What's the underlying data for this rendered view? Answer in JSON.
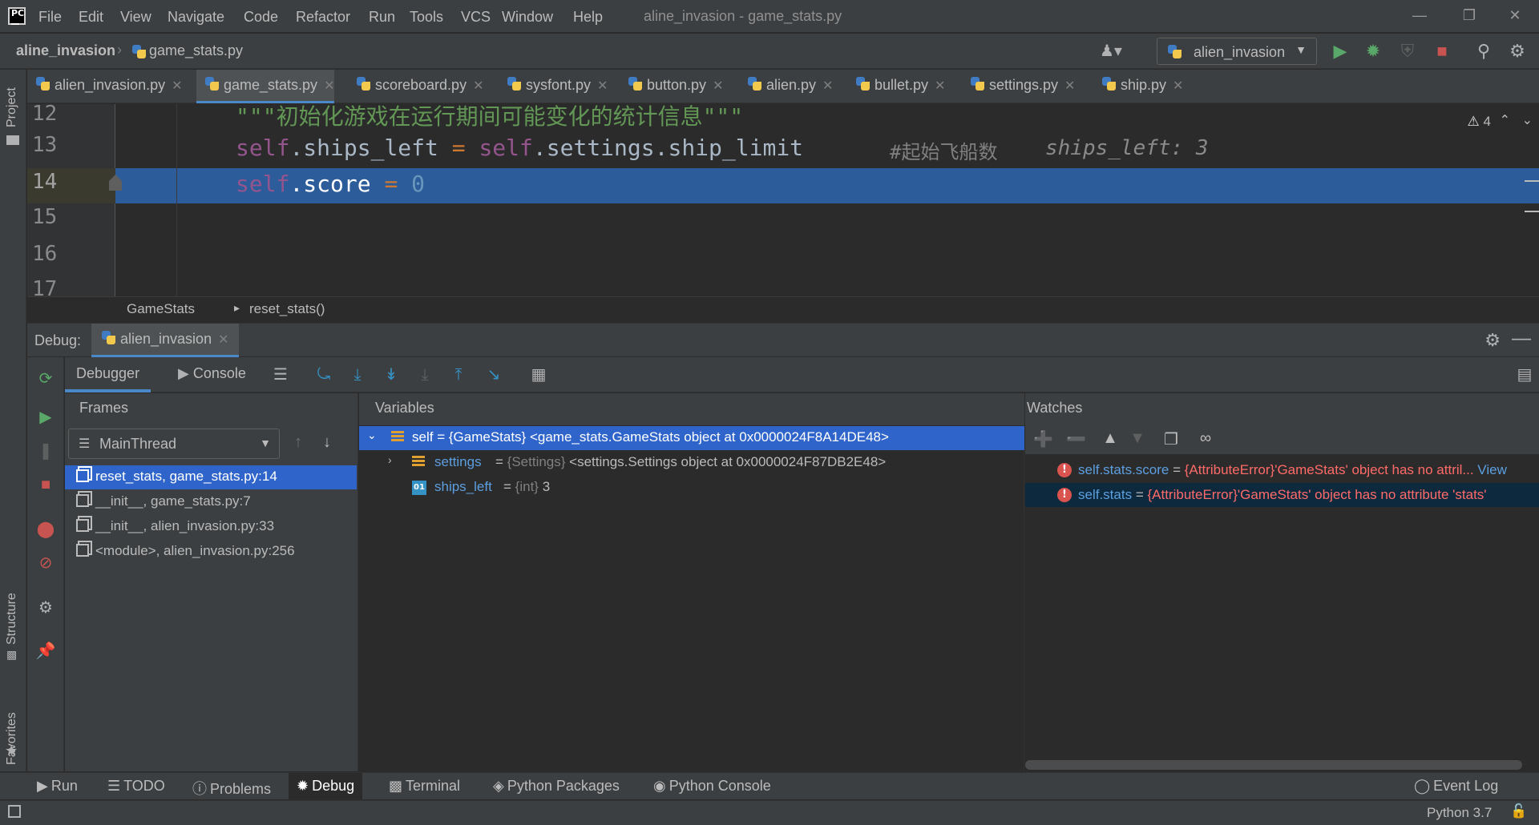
{
  "menu": [
    "File",
    "Edit",
    "View",
    "Navigate",
    "Code",
    "Refactor",
    "Run",
    "Tools",
    "VCS",
    "Window",
    "Help"
  ],
  "window_title": "aline_invasion - game_stats.py",
  "nav": {
    "project": "aline_invasion",
    "file": "game_stats.py",
    "run_config": "alien_invasion"
  },
  "editor_tabs": [
    "alien_invasion.py",
    "game_stats.py",
    "scoreboard.py",
    "sysfont.py",
    "button.py",
    "alien.py",
    "bullet.py",
    "settings.py",
    "ship.py"
  ],
  "editor_active_tab": "game_stats.py",
  "editor": {
    "line_numbers": [
      "12",
      "13",
      "14",
      "15",
      "16",
      "17"
    ],
    "line12_docstring": "\"\"\"初始化游戏在运行期间可能变化的统计信息\"\"\"",
    "line13_self": "self",
    "line13_attr": ".ships_left ",
    "line13_eq": "=",
    "line13_self2": " self",
    "line13_rest": ".settings.ship_limit",
    "line13_comment": "#起始飞船数",
    "line13_inlay": "ships_left: 3",
    "line14_self": "self",
    "line14_attr": ".score ",
    "line14_eq": "=",
    "line14_value": " 0",
    "warning_count": "4"
  },
  "code_breadcrumb": {
    "class": "GameStats",
    "method": "reset_stats()"
  },
  "debug": {
    "label": "Debug:",
    "session_tab": "alien_invasion",
    "debugger_tab": "Debugger",
    "console_tab": "Console"
  },
  "frames": {
    "title": "Frames",
    "thread": "MainThread",
    "items": [
      "reset_stats, game_stats.py:14",
      "__init__, game_stats.py:7",
      "__init__, alien_invasion.py:33",
      "<module>, alien_invasion.py:256"
    ]
  },
  "variables": {
    "title": "Variables",
    "items": [
      {
        "name": "self",
        "eq": " = ",
        "type": "{GameStats}",
        "value": " <game_stats.GameStats object at 0x0000024F8A14DE48>"
      },
      {
        "name": "settings",
        "eq": " = ",
        "type": "{Settings}",
        "value": " <settings.Settings object at 0x0000024F87DB2E48>"
      },
      {
        "name": "ships_left",
        "eq": " = ",
        "type": "{int}",
        "value": " 3",
        "badge": "01"
      }
    ]
  },
  "watches": {
    "title": "Watches",
    "items": [
      {
        "name": "self.stats.score",
        "eq": " = ",
        "value": "{AttributeError}'GameStats' object has no attril...",
        "link": " View"
      },
      {
        "name": "self.stats",
        "eq": " = ",
        "value": "{AttributeError}'GameStats' object has no attribute 'stats'"
      }
    ]
  },
  "left_stripe": {
    "project": "Project",
    "structure": "Structure",
    "favorites": "Favorites"
  },
  "bottom_bar": {
    "run": "Run",
    "todo": "TODO",
    "problems": "Problems",
    "debug": "Debug",
    "terminal": "Terminal",
    "python_packages": "Python Packages",
    "python_console": "Python Console",
    "event_log": "Event Log"
  },
  "status": {
    "interpreter": "Python 3.7"
  },
  "colors": {
    "accent": "#4a88c7",
    "selection": "#2f65ca",
    "current_line": "#2d5c9b",
    "error": "#ff6b68",
    "keyword_self": "#94558d"
  },
  "icons": {
    "run": "play-icon",
    "debug": "bug-icon",
    "stop": "stop-icon",
    "search": "search-icon",
    "settings": "gear-icon"
  }
}
